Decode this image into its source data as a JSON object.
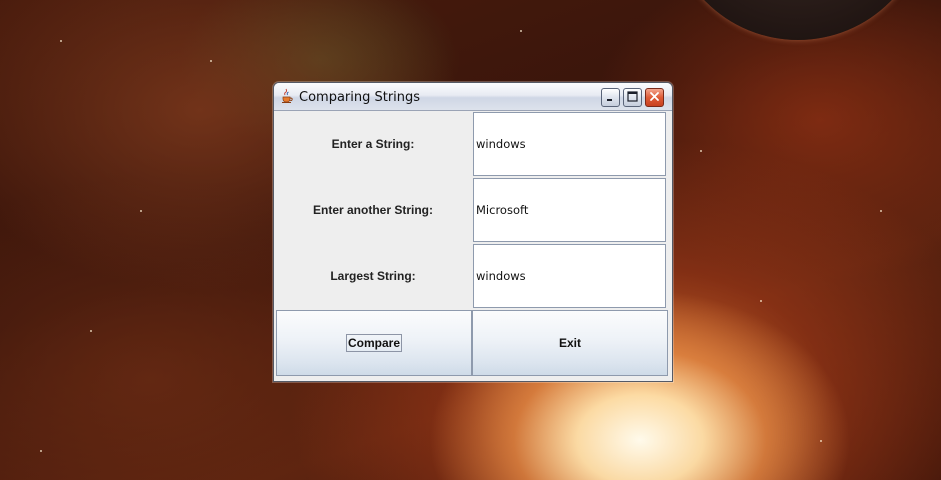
{
  "window": {
    "title": "Comparing Strings",
    "app_icon": "java-cup-icon"
  },
  "form": {
    "first_label": "Enter a String:",
    "first_value": "windows",
    "second_label": "Enter another String:",
    "second_value": "Microsoft",
    "result_label": "Largest String:",
    "result_value": "windows"
  },
  "buttons": {
    "compare": "Compare",
    "exit": "Exit"
  },
  "colors": {
    "close_button": "#de5b37",
    "panel_background": "#eeeeee"
  }
}
